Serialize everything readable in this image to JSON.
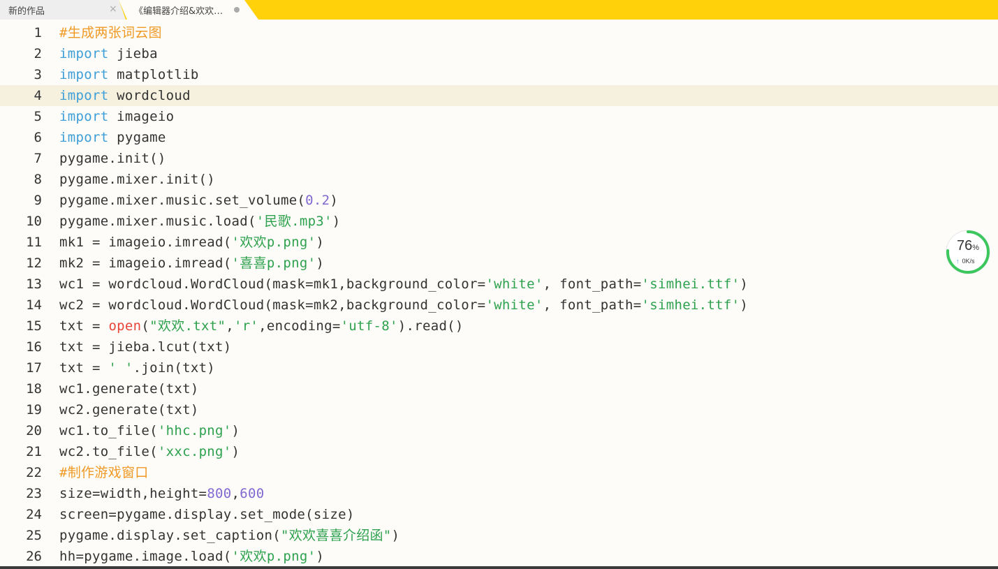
{
  "tabs": [
    {
      "label": "新的作品",
      "active": false
    },
    {
      "label": "《编辑器介绍&欢欢喜喜介绍函》",
      "active": true
    }
  ],
  "widget": {
    "percent": "76",
    "percent_unit": "%",
    "speed": "0K/s"
  },
  "colors": {
    "tabbar": "#ffd10a",
    "keyword": "#3e9ed8",
    "string": "#2ea14e",
    "number": "#8169d1",
    "builtin": "#e8443a",
    "comment": "#f09a26",
    "current_line": "#f6f1df"
  },
  "current_line": 4,
  "lines": [
    [
      {
        "t": "com",
        "v": "#生成两张词云图"
      }
    ],
    [
      {
        "t": "kw",
        "v": "import"
      },
      {
        "t": "",
        "v": " jieba"
      }
    ],
    [
      {
        "t": "kw",
        "v": "import"
      },
      {
        "t": "",
        "v": " matplotlib"
      }
    ],
    [
      {
        "t": "kw",
        "v": "import"
      },
      {
        "t": "",
        "v": " wordcloud"
      }
    ],
    [
      {
        "t": "kw",
        "v": "import"
      },
      {
        "t": "",
        "v": " imageio"
      }
    ],
    [
      {
        "t": "kw",
        "v": "import"
      },
      {
        "t": "",
        "v": " pygame"
      }
    ],
    [
      {
        "t": "",
        "v": "pygame.init()"
      }
    ],
    [
      {
        "t": "",
        "v": "pygame.mixer.init()"
      }
    ],
    [
      {
        "t": "",
        "v": "pygame.mixer.music.set_volume("
      },
      {
        "t": "num",
        "v": "0.2"
      },
      {
        "t": "",
        "v": ")"
      }
    ],
    [
      {
        "t": "",
        "v": "pygame.mixer.music.load("
      },
      {
        "t": "str",
        "v": "'民歌.mp3'"
      },
      {
        "t": "",
        "v": ")"
      }
    ],
    [
      {
        "t": "",
        "v": "mk1 = imageio.imread("
      },
      {
        "t": "str",
        "v": "'欢欢p.png'"
      },
      {
        "t": "",
        "v": ")"
      }
    ],
    [
      {
        "t": "",
        "v": "mk2 = imageio.imread("
      },
      {
        "t": "str",
        "v": "'喜喜p.png'"
      },
      {
        "t": "",
        "v": ")"
      }
    ],
    [
      {
        "t": "",
        "v": "wc1 = wordcloud.WordCloud(mask=mk1,background_color="
      },
      {
        "t": "str",
        "v": "'white'"
      },
      {
        "t": "",
        "v": ", font_path="
      },
      {
        "t": "str",
        "v": "'simhei.ttf'"
      },
      {
        "t": "",
        "v": ")"
      }
    ],
    [
      {
        "t": "",
        "v": "wc2 = wordcloud.WordCloud(mask=mk2,background_color="
      },
      {
        "t": "str",
        "v": "'white'"
      },
      {
        "t": "",
        "v": ", font_path="
      },
      {
        "t": "str",
        "v": "'simhei.ttf'"
      },
      {
        "t": "",
        "v": ")"
      }
    ],
    [
      {
        "t": "",
        "v": "txt = "
      },
      {
        "t": "fn",
        "v": "open"
      },
      {
        "t": "",
        "v": "("
      },
      {
        "t": "str",
        "v": "\"欢欢.txt\""
      },
      {
        "t": "",
        "v": ","
      },
      {
        "t": "str",
        "v": "'r'"
      },
      {
        "t": "",
        "v": ",encoding="
      },
      {
        "t": "str",
        "v": "'utf-8'"
      },
      {
        "t": "",
        "v": ").read()"
      }
    ],
    [
      {
        "t": "",
        "v": "txt = jieba.lcut(txt)"
      }
    ],
    [
      {
        "t": "",
        "v": "txt = "
      },
      {
        "t": "str",
        "v": "' '"
      },
      {
        "t": "",
        "v": ".join(txt)"
      }
    ],
    [
      {
        "t": "",
        "v": "wc1.generate(txt)"
      }
    ],
    [
      {
        "t": "",
        "v": "wc2.generate(txt)"
      }
    ],
    [
      {
        "t": "",
        "v": "wc1.to_file("
      },
      {
        "t": "str",
        "v": "'hhc.png'"
      },
      {
        "t": "",
        "v": ")"
      }
    ],
    [
      {
        "t": "",
        "v": "wc2.to_file("
      },
      {
        "t": "str",
        "v": "'xxc.png'"
      },
      {
        "t": "",
        "v": ")"
      }
    ],
    [
      {
        "t": "com",
        "v": "#制作游戏窗口"
      }
    ],
    [
      {
        "t": "",
        "v": "size=width,height="
      },
      {
        "t": "num",
        "v": "800"
      },
      {
        "t": "",
        "v": ","
      },
      {
        "t": "num",
        "v": "600"
      }
    ],
    [
      {
        "t": "",
        "v": "screen=pygame.display.set_mode(size)"
      }
    ],
    [
      {
        "t": "",
        "v": "pygame.display.set_caption("
      },
      {
        "t": "str",
        "v": "\"欢欢喜喜介绍函\""
      },
      {
        "t": "",
        "v": ")"
      }
    ],
    [
      {
        "t": "",
        "v": "hh=pygame.image.load("
      },
      {
        "t": "str",
        "v": "'欢欢p.png'"
      },
      {
        "t": "",
        "v": ")"
      }
    ]
  ]
}
